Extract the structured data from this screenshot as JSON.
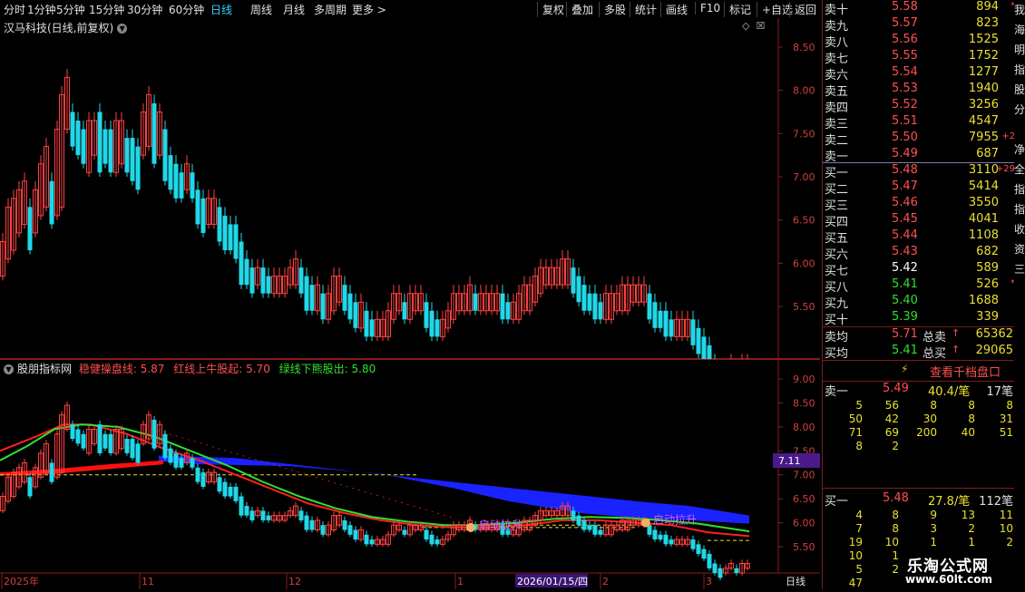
{
  "toolbar": {
    "periods": [
      "分时",
      "1分钟",
      "5分钟",
      "15分钟",
      "30分钟",
      "60分钟",
      "日线",
      "周线",
      "月线",
      "多周期",
      "更多 >"
    ],
    "active_period": "日线",
    "buttons": [
      "复权",
      "叠加",
      "多股",
      "统计",
      "画线",
      "F10",
      "标记",
      "+自选",
      "返回"
    ]
  },
  "main_chart": {
    "title": "汉马科技(日线,前复权)",
    "y_ticks": [
      "8.50",
      "8.00",
      "7.50",
      "7.00",
      "6.50",
      "6.00",
      "5.50"
    ],
    "candles": [
      [
        3,
        5.9,
        6.2
      ],
      [
        9,
        6.1,
        6.6
      ],
      [
        15,
        6.2,
        6.7
      ],
      [
        21,
        6.4,
        6.8
      ],
      [
        27,
        6.5,
        6.9
      ],
      [
        33,
        6.2,
        6.6
      ],
      [
        39,
        6.4,
        6.8
      ],
      [
        45,
        6.6,
        7.1
      ],
      [
        51,
        6.7,
        7.3
      ],
      [
        57,
        6.5,
        6.9
      ],
      [
        63,
        6.6,
        7.5
      ],
      [
        68,
        6.7,
        7.9
      ],
      [
        74,
        7.6,
        8.1
      ],
      [
        80,
        7.4,
        7.7
      ],
      [
        86,
        7.3,
        7.6
      ],
      [
        92,
        7.2,
        7.5
      ],
      [
        98,
        7.1,
        7.6
      ],
      [
        104,
        7.3,
        7.6
      ],
      [
        110,
        7.1,
        7.7
      ],
      [
        116,
        7.2,
        7.5
      ],
      [
        122,
        7.1,
        7.5
      ],
      [
        128,
        7.1,
        7.6
      ],
      [
        134,
        7.2,
        7.6
      ],
      [
        140,
        7.1,
        7.4
      ],
      [
        146,
        7.0,
        7.4
      ],
      [
        152,
        6.9,
        7.3
      ],
      [
        158,
        7.3,
        7.7
      ],
      [
        164,
        7.4,
        7.9
      ],
      [
        170,
        7.2,
        7.8
      ],
      [
        176,
        7.3,
        7.7
      ],
      [
        182,
        7.0,
        7.5
      ],
      [
        188,
        6.9,
        7.2
      ],
      [
        194,
        6.8,
        7.1
      ],
      [
        200,
        6.8,
        7.0
      ],
      [
        206,
        6.9,
        7.1
      ],
      [
        212,
        6.8,
        7.0
      ],
      [
        218,
        6.5,
        6.8
      ],
      [
        224,
        6.4,
        6.7
      ],
      [
        230,
        6.5,
        6.7
      ],
      [
        236,
        6.5,
        6.7
      ],
      [
        242,
        6.3,
        6.6
      ],
      [
        248,
        6.2,
        6.5
      ],
      [
        254,
        6.2,
        6.4
      ],
      [
        260,
        6.1,
        6.4
      ],
      [
        266,
        5.8,
        6.2
      ],
      [
        272,
        5.8,
        6.0
      ],
      [
        278,
        5.7,
        5.9
      ],
      [
        284,
        5.8,
        5.9
      ],
      [
        290,
        5.7,
        5.9
      ],
      [
        296,
        5.7,
        5.8
      ],
      [
        302,
        5.7,
        5.8
      ],
      [
        308,
        5.7,
        5.8
      ],
      [
        314,
        5.7,
        5.8
      ],
      [
        320,
        5.8,
        5.9
      ],
      [
        326,
        5.8,
        6.0
      ],
      [
        332,
        5.7,
        5.9
      ],
      [
        338,
        5.5,
        5.8
      ],
      [
        344,
        5.5,
        5.7
      ],
      [
        350,
        5.5,
        5.7
      ],
      [
        356,
        5.4,
        5.6
      ],
      [
        362,
        5.4,
        5.6
      ],
      [
        368,
        5.5,
        5.8
      ],
      [
        374,
        5.6,
        5.8
      ],
      [
        380,
        5.5,
        5.7
      ],
      [
        386,
        5.4,
        5.6
      ],
      [
        392,
        5.3,
        5.5
      ],
      [
        398,
        5.3,
        5.5
      ],
      [
        404,
        5.2,
        5.4
      ],
      [
        410,
        5.2,
        5.3
      ],
      [
        416,
        5.2,
        5.3
      ],
      [
        422,
        5.2,
        5.3
      ],
      [
        428,
        5.2,
        5.4
      ],
      [
        434,
        5.4,
        5.6
      ],
      [
        440,
        5.5,
        5.6
      ],
      [
        446,
        5.4,
        5.5
      ],
      [
        452,
        5.4,
        5.6
      ],
      [
        458,
        5.5,
        5.6
      ],
      [
        464,
        5.5,
        5.6
      ],
      [
        470,
        5.3,
        5.5
      ],
      [
        476,
        5.2,
        5.4
      ],
      [
        482,
        5.2,
        5.3
      ],
      [
        488,
        5.2,
        5.3
      ],
      [
        494,
        5.3,
        5.4
      ],
      [
        500,
        5.4,
        5.6
      ],
      [
        506,
        5.5,
        5.6
      ],
      [
        512,
        5.5,
        5.6
      ],
      [
        518,
        5.5,
        5.7
      ],
      [
        524,
        5.5,
        5.6
      ],
      [
        530,
        5.5,
        5.6
      ],
      [
        536,
        5.5,
        5.6
      ],
      [
        542,
        5.5,
        5.6
      ],
      [
        548,
        5.5,
        5.6
      ],
      [
        554,
        5.4,
        5.6
      ],
      [
        560,
        5.4,
        5.5
      ],
      [
        566,
        5.4,
        5.5
      ],
      [
        572,
        5.4,
        5.6
      ],
      [
        578,
        5.5,
        5.7
      ],
      [
        584,
        5.5,
        5.7
      ],
      [
        590,
        5.6,
        5.8
      ],
      [
        596,
        5.7,
        5.9
      ],
      [
        602,
        5.8,
        5.9
      ],
      [
        608,
        5.8,
        5.9
      ],
      [
        614,
        5.8,
        5.9
      ],
      [
        620,
        5.8,
        6.0
      ],
      [
        626,
        5.8,
        6.0
      ],
      [
        632,
        5.7,
        5.9
      ],
      [
        638,
        5.6,
        5.8
      ],
      [
        644,
        5.5,
        5.7
      ],
      [
        650,
        5.5,
        5.6
      ],
      [
        656,
        5.4,
        5.6
      ],
      [
        662,
        5.4,
        5.5
      ],
      [
        668,
        5.4,
        5.6
      ],
      [
        674,
        5.4,
        5.6
      ],
      [
        680,
        5.5,
        5.6
      ],
      [
        686,
        5.5,
        5.7
      ],
      [
        692,
        5.5,
        5.7
      ],
      [
        698,
        5.6,
        5.7
      ],
      [
        704,
        5.6,
        5.7
      ],
      [
        710,
        5.6,
        5.7
      ],
      [
        716,
        5.4,
        5.6
      ],
      [
        722,
        5.3,
        5.5
      ],
      [
        728,
        5.3,
        5.4
      ],
      [
        734,
        5.2,
        5.4
      ],
      [
        740,
        5.2,
        5.3
      ],
      [
        746,
        5.2,
        5.3
      ],
      [
        752,
        5.2,
        5.3
      ],
      [
        758,
        5.2,
        5.3
      ],
      [
        764,
        5.1,
        5.3
      ],
      [
        770,
        5.0,
        5.2
      ],
      [
        776,
        4.9,
        5.1
      ],
      [
        782,
        4.7,
        5.0
      ],
      [
        788,
        4.6,
        4.8
      ],
      [
        794,
        4.5,
        4.7
      ],
      [
        800,
        4.6,
        4.7
      ],
      [
        806,
        4.7,
        4.8
      ],
      [
        812,
        4.6,
        4.7
      ],
      [
        818,
        4.6,
        4.8
      ],
      [
        824,
        4.7,
        4.8
      ]
    ]
  },
  "indicator_chart": {
    "name": "股朋指标网",
    "label_steady": "稳健操盘线: 5.87",
    "label_red": "红线上牛股起: 5.70",
    "label_green": "绿线下熊股出: 5.80",
    "y_ticks": [
      "9.00",
      "8.50",
      "8.00",
      "7.50",
      "7.00",
      "6.50",
      "6.00",
      "5.50"
    ],
    "price_tag": "7.11",
    "annotation_1": "启动拉升",
    "annotation_2": "启动拉升",
    "x_labels": [
      "2025年",
      "11",
      "12",
      "1",
      "2",
      "3"
    ],
    "cursor_date": "2026/01/15/四",
    "period_tag": "日线"
  },
  "order_book": {
    "asks": [
      {
        "label": "卖十",
        "price": "5.58",
        "vol": "894",
        "chg": "*"
      },
      {
        "label": "卖九",
        "price": "5.57",
        "vol": "823",
        "chg": ""
      },
      {
        "label": "卖八",
        "price": "5.56",
        "vol": "1525",
        "chg": ""
      },
      {
        "label": "卖七",
        "price": "5.55",
        "vol": "1752",
        "chg": ""
      },
      {
        "label": "卖六",
        "price": "5.54",
        "vol": "1277",
        "chg": ""
      },
      {
        "label": "卖五",
        "price": "5.53",
        "vol": "1940",
        "chg": ""
      },
      {
        "label": "卖四",
        "price": "5.52",
        "vol": "3256",
        "chg": ""
      },
      {
        "label": "卖三",
        "price": "5.51",
        "vol": "4547",
        "chg": ""
      },
      {
        "label": "卖二",
        "price": "5.50",
        "vol": "7955",
        "chg": "+2"
      },
      {
        "label": "卖一",
        "price": "5.49",
        "vol": "687",
        "chg": ""
      }
    ],
    "bids": [
      {
        "label": "买一",
        "price": "5.48",
        "vol": "3110",
        "chg": "+29",
        "pc": "red"
      },
      {
        "label": "买二",
        "price": "5.47",
        "vol": "5414",
        "chg": "",
        "pc": "red"
      },
      {
        "label": "买三",
        "price": "5.46",
        "vol": "3550",
        "chg": "",
        "pc": "red"
      },
      {
        "label": "买四",
        "price": "5.45",
        "vol": "4041",
        "chg": "",
        "pc": "red"
      },
      {
        "label": "买五",
        "price": "5.44",
        "vol": "1108",
        "chg": "",
        "pc": "red"
      },
      {
        "label": "买六",
        "price": "5.43",
        "vol": "682",
        "chg": "",
        "pc": "red"
      },
      {
        "label": "买七",
        "price": "5.42",
        "vol": "589",
        "chg": "",
        "pc": "white"
      },
      {
        "label": "买八",
        "price": "5.41",
        "vol": "526",
        "chg": "*",
        "pc": "green"
      },
      {
        "label": "买九",
        "price": "5.40",
        "vol": "1688",
        "chg": "",
        "pc": "green"
      },
      {
        "label": "买十",
        "price": "5.39",
        "vol": "339",
        "chg": "",
        "pc": "green"
      }
    ],
    "sell_avg_label": "卖均",
    "sell_avg": "5.71",
    "total_sell_label": "总卖",
    "total_sell": "65362",
    "buy_avg_label": "买均",
    "buy_avg": "5.41",
    "total_buy_label": "总买",
    "total_buy": "29065",
    "queue_button": "查看千档盘口",
    "ask1_label": "卖一",
    "ask1_price": "5.49",
    "ask1_avg": "40.4/笔",
    "ask1_count": "17笔",
    "ask1_queue": [
      [
        "5",
        "56",
        "8",
        "8",
        "8"
      ],
      [
        "50",
        "42",
        "30",
        "8",
        "31"
      ],
      [
        "71",
        "69",
        "200",
        "40",
        "51"
      ],
      [
        "8",
        "2",
        "",
        "",
        ""
      ]
    ],
    "bid1_label": "买一",
    "bid1_price": "5.48",
    "bid1_avg": "27.8/笔",
    "bid1_count": "112笔",
    "bid1_queue": [
      [
        "4",
        "8",
        "9",
        "13",
        "11"
      ],
      [
        "7",
        "8",
        "3",
        "2",
        "10"
      ],
      [
        "19",
        "10",
        "1",
        "1",
        "2"
      ],
      [
        "10",
        "1",
        "",
        "",
        ""
      ],
      [
        "5",
        "2",
        "",
        "",
        ""
      ],
      [
        "47",
        "",
        "",
        "",
        ""
      ]
    ]
  },
  "watermark": {
    "title": "乐淘公式网",
    "url": "www.60lt.com"
  },
  "right_strip_chars": [
    "我",
    "海",
    "明",
    "指",
    "股",
    "分",
    "",
    "净",
    "全",
    "指",
    "指",
    "收",
    "资",
    "三"
  ]
}
